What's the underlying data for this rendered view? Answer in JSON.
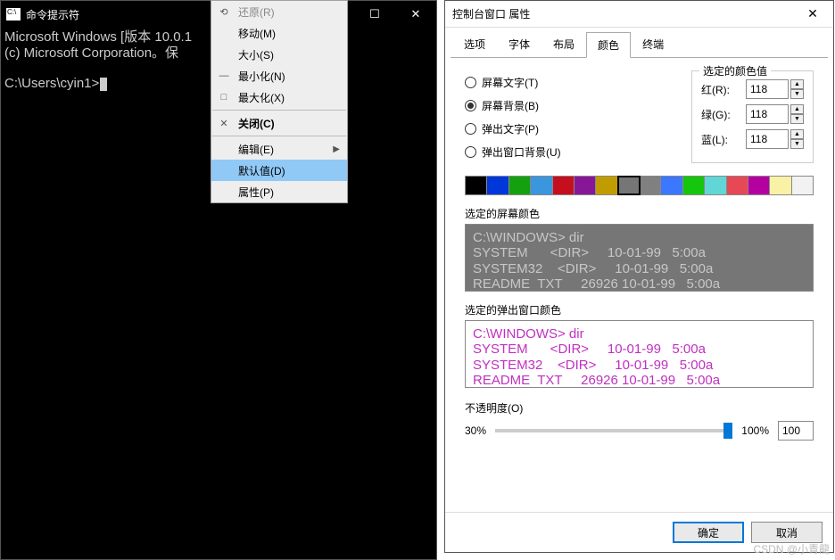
{
  "cmd": {
    "title": "命令提示符",
    "line1": "Microsoft Windows [版本 10.0.1",
    "line2": "(c) Microsoft Corporation。保",
    "prompt": "C:\\Users\\cyin1>"
  },
  "menu": {
    "restore": "还原(R)",
    "move": "移动(M)",
    "size": "大小(S)",
    "minimize": "最小化(N)",
    "maximize": "最大化(X)",
    "close": "关闭(C)",
    "edit": "编辑(E)",
    "defaults": "默认值(D)",
    "properties": "属性(P)"
  },
  "props": {
    "title": "控制台窗口 属性",
    "tabs": {
      "options": "选项",
      "font": "字体",
      "layout": "布局",
      "colors": "颜色",
      "terminal": "终端"
    },
    "radios": {
      "screenText": "屏幕文字(T)",
      "screenBg": "屏幕背景(B)",
      "popupText": "弹出文字(P)",
      "popupBg": "弹出窗口背景(U)"
    },
    "colorValues": {
      "legend": "选定的颜色值",
      "red": "红(R):",
      "green": "绿(G):",
      "blue": "蓝(L):",
      "r": "118",
      "g": "118",
      "b": "118"
    },
    "swatchColors": [
      "#000000",
      "#0037da",
      "#13a10e",
      "#3a96dd",
      "#c50f1f",
      "#881798",
      "#c19c00",
      "#767676",
      "#808080",
      "#3b78ff",
      "#16c60c",
      "#61d6d6",
      "#e74856",
      "#b4009e",
      "#f9f1a5",
      "#f2f2f2"
    ],
    "selectedSwatch": 7,
    "previewScreen": {
      "label": "选定的屏幕颜色",
      "rows": [
        "C:\\WINDOWS> dir",
        "SYSTEM      <DIR>     10-01-99   5:00a",
        "SYSTEM32    <DIR>     10-01-99   5:00a",
        "README  TXT     26926 10-01-99   5:00a"
      ]
    },
    "previewPopup": {
      "label": "选定的弹出窗口颜色",
      "rows": [
        "C:\\WINDOWS> dir",
        "SYSTEM      <DIR>     10-01-99   5:00a",
        "SYSTEM32    <DIR>     10-01-99   5:00a",
        "README  TXT     26926 10-01-99   5:00a"
      ]
    },
    "opacity": {
      "label": "不透明度(O)",
      "min": "30%",
      "max": "100%",
      "value": "100"
    }
  },
  "buttons": {
    "ok": "确定",
    "cancel": "取消"
  },
  "watermark": "CSDN @小青龍"
}
